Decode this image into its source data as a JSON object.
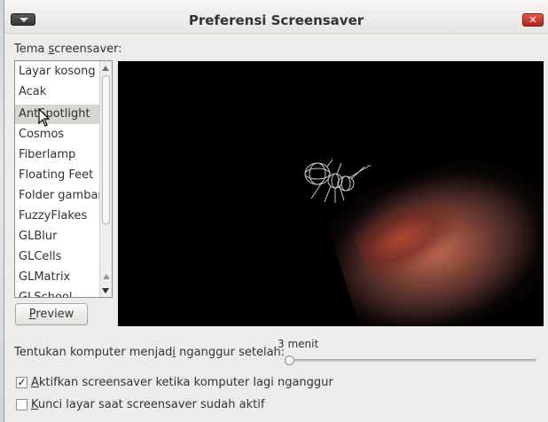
{
  "window": {
    "title": "Preferensi Screensaver",
    "close_label": "✕"
  },
  "theme": {
    "label_pre": "Tema ",
    "label_mnemonic": "s",
    "label_post": "creensaver:",
    "items": [
      {
        "label": "Layar kosong"
      },
      {
        "label": "Acak"
      },
      {
        "label": "AntSpotlight"
      },
      {
        "label": "Cosmos"
      },
      {
        "label": "Fiberlamp"
      },
      {
        "label": "Floating Feet"
      },
      {
        "label": "Folder gambar"
      },
      {
        "label": "FuzzyFlakes"
      },
      {
        "label": "GLBlur"
      },
      {
        "label": "GLCells"
      },
      {
        "label": "GLMatrix"
      },
      {
        "label": "GLSchool"
      }
    ],
    "selected_index": 2
  },
  "preview": {
    "button_mnemonic": "P",
    "button_rest": "review"
  },
  "idle": {
    "label_pre": "Tentukan komputer menjad",
    "label_mnemonic": "i",
    "label_post": " nganggur setelah:",
    "value": "3 menit",
    "slider_fraction": 0.0
  },
  "options": {
    "activate_checked": true,
    "activate_mnemonic": "A",
    "activate_rest": "ktifkan screensaver ketika komputer lagi nganggur",
    "lock_checked": false,
    "lock_mnemonic": "K",
    "lock_rest": "unci layar saat screensaver sudah aktif",
    "check_mark": "✓"
  },
  "colors": {
    "selected_row": "#d6d8d0",
    "preview_bg": "#000000",
    "close_red": "#c8392b"
  }
}
